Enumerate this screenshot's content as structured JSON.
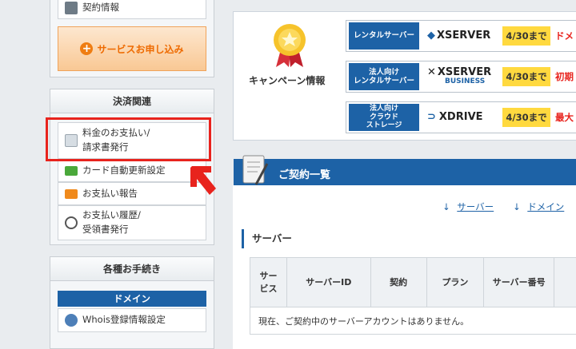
{
  "sidebar": {
    "contract_info": "契約情報",
    "apply_button": "サービスお申し込み",
    "payment_section": {
      "title": "決済関連",
      "items": [
        {
          "label_line1": "料金のお支払い/",
          "label_line2": "請求書発行",
          "icon": "invoice-icon"
        },
        {
          "label_line1": "カード自動更新設定",
          "icon": "credit-card-icon"
        },
        {
          "label_line1": "お支払い報告",
          "icon": "chat-report-icon"
        },
        {
          "label_line1": "お支払い履歴/",
          "label_line2": "受領書発行",
          "icon": "clock-icon"
        }
      ]
    },
    "procedures_section": {
      "title": "各種お手続き",
      "domain_header": "ドメイン",
      "whois_item": "Whois登録情報設定"
    }
  },
  "campaign": {
    "title": "キャンペーン情報",
    "rows": [
      {
        "label": "レンタルサーバー",
        "brand": "XSERVER",
        "date": "4/30まで",
        "tail": "ドメ"
      },
      {
        "label_line1": "法人向け",
        "label_line2": "レンタルサーバー",
        "brand": "XSERVER",
        "brand_sub": "BUSINESS",
        "date": "4/30まで",
        "tail": "初期"
      },
      {
        "label_line1": "法人向け",
        "label_line2": "クラウド",
        "label_line3": "ストレージ",
        "brand": "XDRIVE",
        "date": "4/30まで",
        "tail": "最大"
      }
    ]
  },
  "contracts": {
    "title": "ご契約一覧",
    "links": {
      "server": "サーバー",
      "domain": "ドメイン"
    },
    "server_section": {
      "title": "サーバー",
      "columns": [
        "サービス",
        "サーバーID",
        "契約",
        "プラン",
        "サーバー番号"
      ],
      "empty_message": "現在、ご契約中のサーバーアカウントはありません。"
    }
  },
  "colors": {
    "accent": "#1d62a6",
    "highlight": "#e8231d",
    "date_badge": "#ffd93f",
    "apply_text": "#ee6a00"
  }
}
